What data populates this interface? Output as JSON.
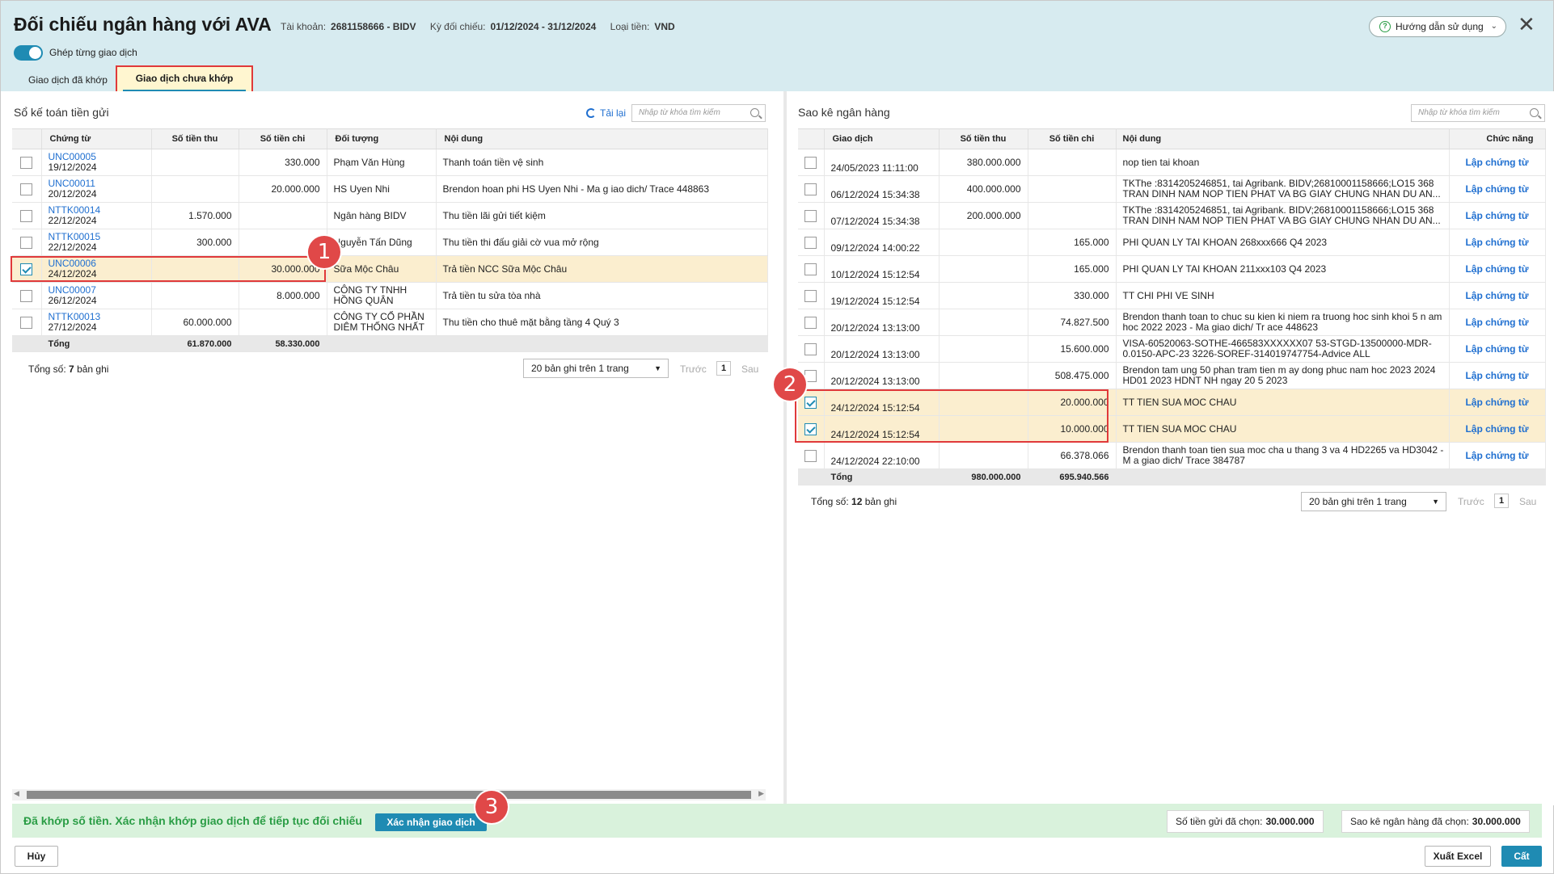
{
  "header": {
    "title": "Đối chiếu ngân hàng với AVA",
    "account_label": "Tài khoản:",
    "account_value": "2681158666 - BIDV",
    "period_label": "Kỳ đối chiếu:",
    "period_value": "01/12/2024 - 31/12/2024",
    "currency_label": "Loại tiền:",
    "currency_value": "VND",
    "guide_label": "Hướng dẫn sử dụng",
    "toggle_label": "Ghép từng giao dịch",
    "tabs": [
      "Giao dịch đã khớp",
      "Giao dịch chưa khớp"
    ]
  },
  "left": {
    "title": "Sổ kế toán tiền gửi",
    "reload": "Tải lại",
    "search_placeholder": "Nhập từ khóa tìm kiếm",
    "columns": [
      "Chứng từ",
      "Số tiền thu",
      "Số tiền chi",
      "Đối tượng",
      "Nội dung"
    ],
    "rows": [
      {
        "code": "UNC00005",
        "date": "19/12/2024",
        "thu": "",
        "chi": "330.000",
        "obj": "Phạm Văn Hùng",
        "content": "Thanh toán tiền vệ sinh",
        "checked": false
      },
      {
        "code": "UNC00011",
        "date": "20/12/2024",
        "thu": "",
        "chi": "20.000.000",
        "obj": "HS Uyen Nhi",
        "content": "Brendon hoan phi HS Uyen Nhi - Ma g iao dich/ Trace 448863",
        "checked": false
      },
      {
        "code": "NTTK00014",
        "date": "22/12/2024",
        "thu": "1.570.000",
        "chi": "",
        "obj": "Ngân hàng BIDV",
        "content": "Thu tiền lãi gửi tiết kiệm",
        "checked": false
      },
      {
        "code": "NTTK00015",
        "date": "22/12/2024",
        "thu": "300.000",
        "chi": "",
        "obj": "Nguyễn Tấn Dũng",
        "content": "Thu tiền thi đấu giải cờ vua mở rộng",
        "checked": false
      },
      {
        "code": "UNC00006",
        "date": "24/12/2024",
        "thu": "",
        "chi": "30.000.000",
        "obj": "Sữa Mộc Châu",
        "content": "Trả tiền NCC Sữa Mộc Châu",
        "checked": true
      },
      {
        "code": "UNC00007",
        "date": "26/12/2024",
        "thu": "",
        "chi": "8.000.000",
        "obj": "CÔNG TY TNHH HỒNG QUÂN",
        "content": "Trả tiền tu sửa tòa nhà",
        "checked": false
      },
      {
        "code": "NTTK00013",
        "date": "27/12/2024",
        "thu": "60.000.000",
        "chi": "",
        "obj": "CÔNG TY CỔ PHẦN DIÊM THỐNG NHẤT",
        "content": "Thu tiền cho thuê mặt bằng tầng 4 Quý 3",
        "checked": false
      }
    ],
    "total_label": "Tổng",
    "total_thu": "61.870.000",
    "total_chi": "58.330.000",
    "count_label": "Tổng số:",
    "count_value": "7",
    "count_suffix": "bản ghi",
    "page_size": "20 bản ghi trên 1 trang",
    "prev": "Trước",
    "page": "1",
    "next": "Sau"
  },
  "right": {
    "title": "Sao kê ngân hàng",
    "search_placeholder": "Nhập từ khóa tìm kiếm",
    "columns": [
      "Giao dịch",
      "Số tiền thu",
      "Số tiền chi",
      "Nội dung",
      "Chức năng"
    ],
    "rows": [
      {
        "time": "24/05/2023 11:11:00",
        "thu": "380.000.000",
        "chi": "",
        "content": "nop tien tai khoan",
        "checked": false
      },
      {
        "time": "06/12/2024 15:34:38",
        "thu": "400.000.000",
        "chi": "",
        "content": "TKThe :8314205246851, tai Agribank. BIDV;26810001158666;LO15 368 TRAN DINH NAM NOP TIEN PHAT VA BG GIAY CHUNG NHAN DU AN...",
        "checked": false
      },
      {
        "time": "07/12/2024 15:34:38",
        "thu": "200.000.000",
        "chi": "",
        "content": "TKThe :8314205246851, tai Agribank. BIDV;26810001158666;LO15 368 TRAN DINH NAM NOP TIEN PHAT VA BG GIAY CHUNG NHAN DU AN...",
        "checked": false
      },
      {
        "time": "09/12/2024 14:00:22",
        "thu": "",
        "chi": "165.000",
        "content": "PHI QUAN LY TAI KHOAN 268xxx666 Q4 2023",
        "checked": false
      },
      {
        "time": "10/12/2024 15:12:54",
        "thu": "",
        "chi": "165.000",
        "content": "PHI QUAN LY TAI KHOAN 211xxx103 Q4 2023",
        "checked": false
      },
      {
        "time": "19/12/2024 15:12:54",
        "thu": "",
        "chi": "330.000",
        "content": "TT CHI PHI VE SINH",
        "checked": false
      },
      {
        "time": "20/12/2024 13:13:00",
        "thu": "",
        "chi": "74.827.500",
        "content": "Brendon thanh toan to chuc su kien ki niem ra truong hoc sinh khoi 5 n am hoc 2022 2023 - Ma giao dich/ Tr ace 448623",
        "checked": false
      },
      {
        "time": "20/12/2024 13:13:00",
        "thu": "",
        "chi": "15.600.000",
        "content": "VISA-60520063-SOTHE-466583XXXXXX07 53-STGD-13500000-MDR-0.0150-APC-23 3226-SOREF-314019747754-Advice ALL",
        "checked": false
      },
      {
        "time": "20/12/2024 13:13:00",
        "thu": "",
        "chi": "508.475.000",
        "content": "Brendon tam ung 50 phan tram tien m ay dong phuc nam hoc 2023 2024 HD01 2023 HDNT NH ngay 20 5 2023",
        "checked": false
      },
      {
        "time": "24/12/2024 15:12:54",
        "thu": "",
        "chi": "20.000.000",
        "content": "TT TIEN SUA MOC CHAU",
        "checked": true
      },
      {
        "time": "24/12/2024 15:12:54",
        "thu": "",
        "chi": "10.000.000",
        "content": "TT TIEN SUA MOC CHAU",
        "checked": true
      },
      {
        "time": "24/12/2024 22:10:00",
        "thu": "",
        "chi": "66.378.066",
        "content": "Brendon thanh toan tien sua moc cha u thang 3 va 4 HD2265 va HD3042 - M a giao dich/ Trace 384787",
        "checked": false
      }
    ],
    "action_label": "Lập chứng từ",
    "total_label": "Tổng",
    "total_thu": "980.000.000",
    "total_chi": "695.940.566",
    "count_label": "Tổng số:",
    "count_value": "12",
    "count_suffix": "bản ghi",
    "page_size": "20 bản ghi trên 1 trang",
    "prev": "Trước",
    "page": "1",
    "next": "Sau"
  },
  "markers": [
    "1",
    "2",
    "3"
  ],
  "status_bar": {
    "message": "Đã khớp số tiền. Xác nhận khớp giao dịch để tiếp tục đối chiếu",
    "confirm_label": "Xác nhận giao dịch",
    "left_selected_label": "Số tiền gửi đã chọn:",
    "left_selected_value": "30.000.000",
    "right_selected_label": "Sao kê ngân hàng đã chọn:",
    "right_selected_value": "30.000.000"
  },
  "footer": {
    "cancel": "Hủy",
    "export": "Xuất Excel",
    "save": "Cất"
  },
  "colors": {
    "header_bg": "#d7ebf0",
    "accent": "#1f8bb3",
    "highlight": "#e0393a",
    "selected_row": "#fbeecf",
    "success_bar": "#d9f2dc",
    "success_text": "#2a9d45"
  }
}
